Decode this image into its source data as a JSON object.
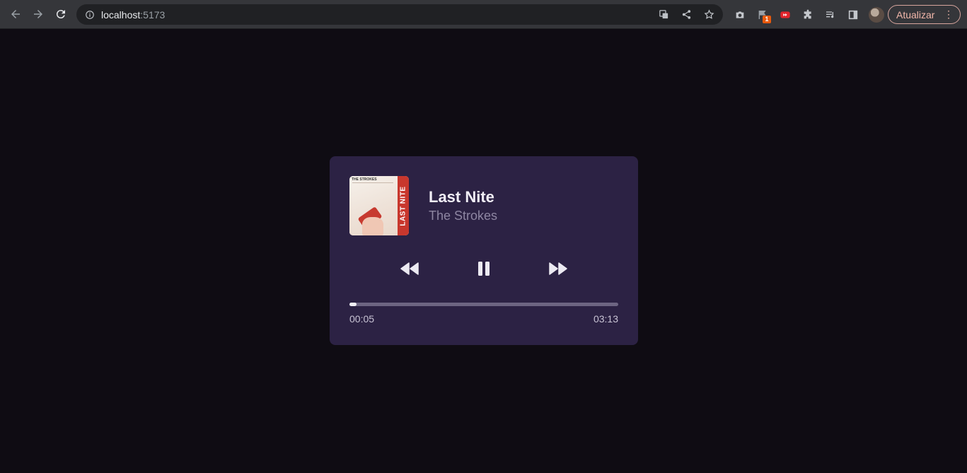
{
  "browser": {
    "url_host": "localhost",
    "url_port": ":5173",
    "update_label": "Atualizar",
    "extension_badge": "1"
  },
  "player": {
    "cover_band": "THE STROKES",
    "cover_spine": "LAST NITE",
    "title": "Last Nite",
    "artist": "The Strokes",
    "current_time": "00:05",
    "total_time": "03:13",
    "progress_fraction": 0.027,
    "colors": {
      "card": "#2c2244",
      "background": "#0f0c13",
      "track": "#6d6582",
      "fill": "#f3f1f7"
    }
  }
}
